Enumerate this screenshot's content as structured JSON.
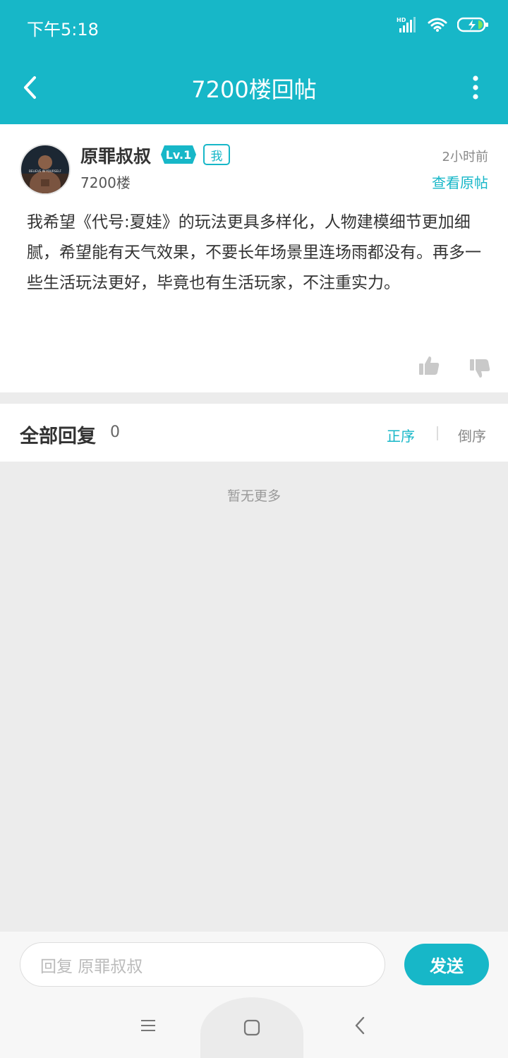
{
  "status_bar": {
    "time": "下午5:18",
    "icons": [
      "signal-hd-icon",
      "wifi-icon",
      "battery-charging-icon"
    ]
  },
  "header": {
    "title": "7200楼回帖",
    "back_icon": "back-arrow-icon",
    "more_icon": "more-vertical-icon"
  },
  "post": {
    "username": "原罪叔叔",
    "level": "Lv.1",
    "me_badge": "我",
    "floor": "7200楼",
    "time_ago": "2小时前",
    "view_original": "查看原帖",
    "content": "我希望《代号:夏娃》的玩法更具多样化，人物建模细节更加细腻，希望能有天气效果，不要长年场景里连场雨都没有。再多一些生活玩法更好，毕竟也有生活玩家，不注重实力。",
    "avatar_caption": "BELIEVE IN YOURSELF",
    "like_icon": "thumbs-up-icon",
    "dislike_icon": "thumbs-down-icon"
  },
  "replies": {
    "title": "全部回复",
    "count": "0",
    "sort_asc": "正序",
    "sort_desc": "倒序",
    "empty_text": "暂无更多"
  },
  "reply_bar": {
    "placeholder": "回复 原罪叔叔",
    "send_label": "发送"
  },
  "nav_bar": {
    "icons": [
      "menu-icon",
      "home-icon",
      "back-icon"
    ]
  },
  "colors": {
    "accent": "#17b7c8",
    "background": "#ececec",
    "text": "#333333"
  }
}
